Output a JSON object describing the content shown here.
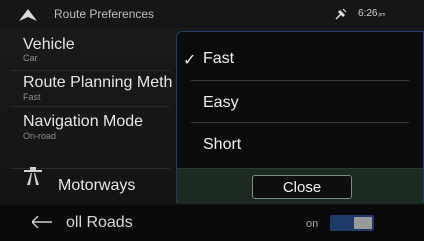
{
  "statusbar": {
    "title": "Route Preferences",
    "time": "6:26",
    "ampm": "pm",
    "nav_icon": "navigation-arrow-icon",
    "gps_icon": "gps-satellite-icon"
  },
  "list": {
    "items": [
      {
        "title": "Vehicle",
        "subtitle": "Car"
      },
      {
        "title": "Route Planning Meth",
        "subtitle": "Fast"
      },
      {
        "title": "Navigation Mode",
        "subtitle": "On-road"
      },
      {
        "title": "Motorways",
        "icon": "motorway-icon"
      }
    ],
    "toll_roads": {
      "label": "oll Roads",
      "state": "on"
    }
  },
  "popup": {
    "options": [
      {
        "label": "Fast",
        "selected": true
      },
      {
        "label": "Easy",
        "selected": false
      },
      {
        "label": "Short",
        "selected": false
      }
    ],
    "check_mark": "✓",
    "close_label": "Close"
  },
  "colors": {
    "accent": "#1e3a66",
    "footer": "#1d2a21"
  }
}
